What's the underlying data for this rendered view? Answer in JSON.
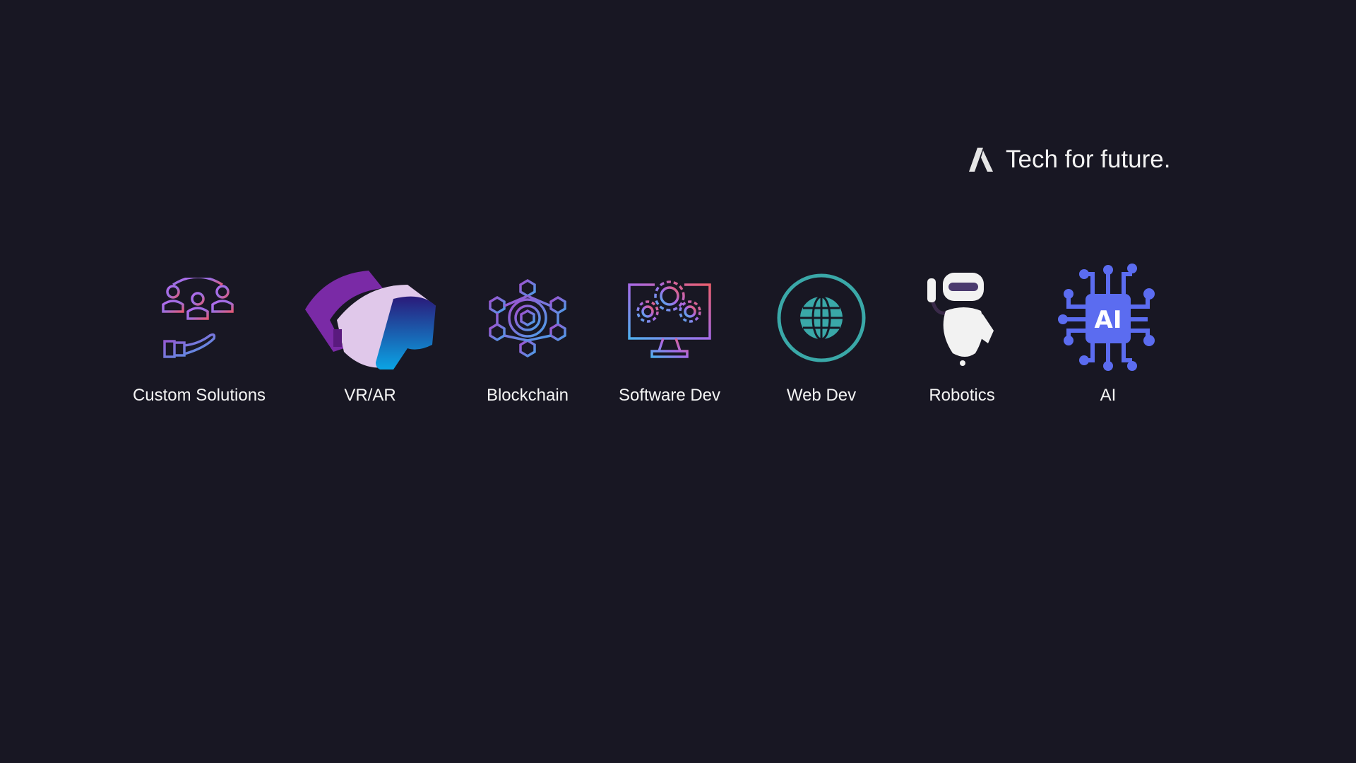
{
  "header": {
    "tagline": "Tech for future."
  },
  "services": [
    {
      "label": "Custom Solutions",
      "icon": "team-hand-icon"
    },
    {
      "label": "VR/AR",
      "icon": "vr-headset-icon"
    },
    {
      "label": "Blockchain",
      "icon": "blockchain-icon"
    },
    {
      "label": "Software Dev",
      "icon": "monitor-gears-icon"
    },
    {
      "label": "Web Dev",
      "icon": "globe-icon"
    },
    {
      "label": "Robotics",
      "icon": "robot-icon"
    },
    {
      "label": "AI",
      "icon": "ai-chip-icon",
      "chip_text": "AI"
    }
  ],
  "colors": {
    "background": "#181723",
    "teal": "#3aa8a8",
    "ai_blue": "#5b6cf0"
  }
}
